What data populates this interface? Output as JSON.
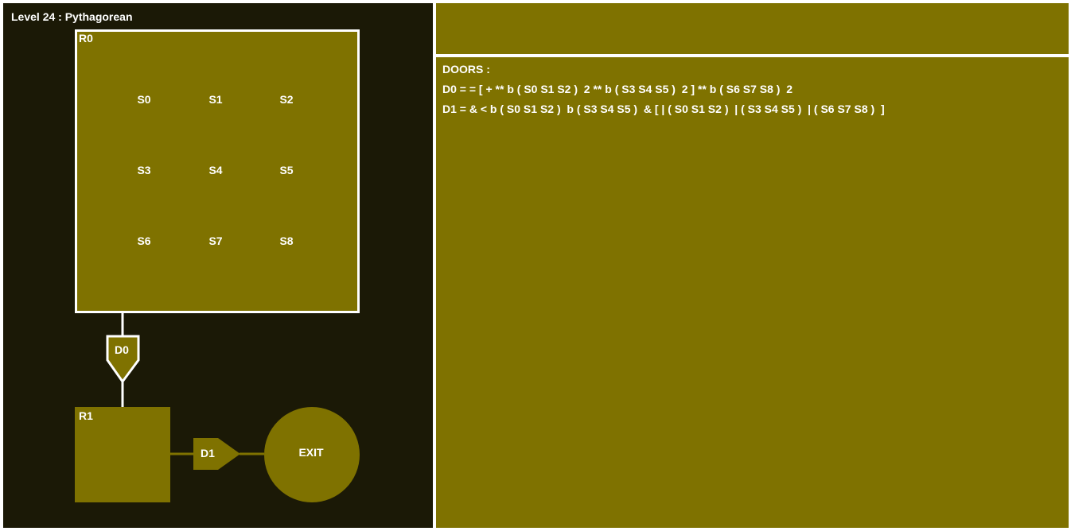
{
  "level": {
    "title": "Level 24 : Pythagorean"
  },
  "colors": {
    "map_background": "#1b1906",
    "olive": "#7f7200",
    "white": "#ffffff"
  },
  "rooms": {
    "r0": {
      "label": "R0",
      "switches": [
        "S0",
        "S1",
        "S2",
        "S3",
        "S4",
        "S5",
        "S6",
        "S7",
        "S8"
      ]
    },
    "r1": {
      "label": "R1"
    }
  },
  "doors": {
    "d0": {
      "label": "D0"
    },
    "d1": {
      "label": "D1"
    }
  },
  "exit": {
    "label": "EXIT"
  },
  "doors_panel": {
    "heading": "DOORS :",
    "lines": [
      "D0 = = [ + ** b ( S0 S1 S2 )  2 ** b ( S3 S4 S5 )  2 ] ** b ( S6 S7 S8 )  2",
      "D1 = & < b ( S0 S1 S2 )  b ( S3 S4 S5 )  & [ | ( S0 S1 S2 )  | ( S3 S4 S5 )  | ( S6 S7 S8 )  ]"
    ]
  }
}
